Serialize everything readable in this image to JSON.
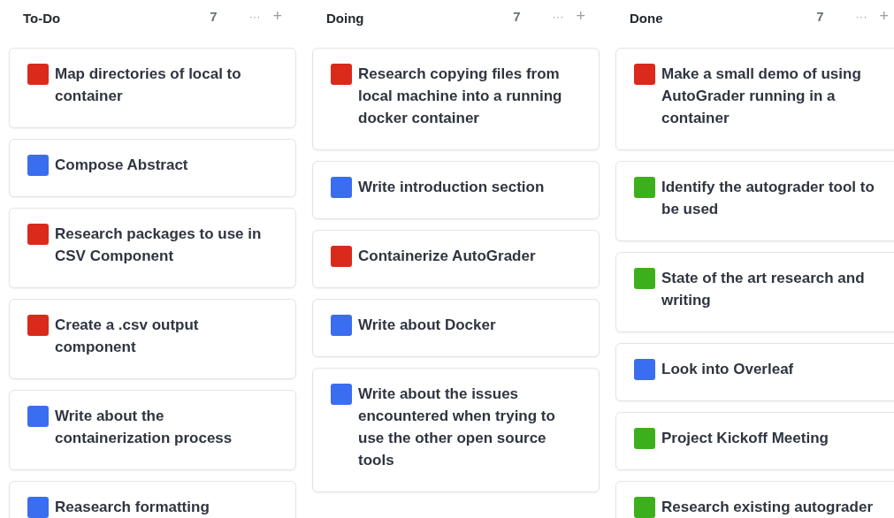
{
  "columns": [
    {
      "title": "To-Do",
      "count": "7",
      "menu": "···",
      "add": "+",
      "cards": [
        {
          "color": "#d92a1c",
          "text": "Map directories of local to container"
        },
        {
          "color": "#3a6df0",
          "text": "Compose Abstract"
        },
        {
          "color": "#d92a1c",
          "text": "Research packages to use in CSV Component"
        },
        {
          "color": "#d92a1c",
          "text": "Create a .csv output component"
        },
        {
          "color": "#3a6df0",
          "text": "Write about the containerization process"
        },
        {
          "color": "#3a6df0",
          "text": "Reasearch formatting"
        }
      ]
    },
    {
      "title": "Doing",
      "count": "7",
      "menu": "···",
      "add": "+",
      "cards": [
        {
          "color": "#d92a1c",
          "text": "Research copying files from local machine into a running docker container"
        },
        {
          "color": "#3a6df0",
          "text": "Write introduction section"
        },
        {
          "color": "#d92a1c",
          "text": "Containerize AutoGrader"
        },
        {
          "color": "#3a6df0",
          "text": "Write about Docker"
        },
        {
          "color": "#3a6df0",
          "text": "Write about the issues encountered when trying to use the other open source tools"
        }
      ]
    },
    {
      "title": "Done",
      "count": "7",
      "menu": "···",
      "add": "+",
      "cards": [
        {
          "color": "#d92a1c",
          "text": "Make a small demo of using AutoGrader running in a container"
        },
        {
          "color": "#3cb01c",
          "text": "Identify the autograder tool to be used"
        },
        {
          "color": "#3cb01c",
          "text": "State of the art research and writing"
        },
        {
          "color": "#3a6df0",
          "text": "Look into Overleaf"
        },
        {
          "color": "#3cb01c",
          "text": "Project Kickoff Meeting"
        },
        {
          "color": "#3cb01c",
          "text": "Research existing autograder"
        }
      ]
    }
  ]
}
